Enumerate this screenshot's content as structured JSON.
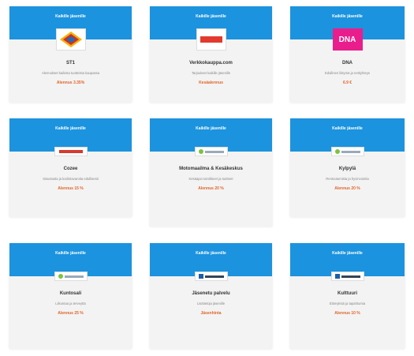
{
  "header_label": "Kaikille jäsenille",
  "accent_color": "#1b93de",
  "offer_color": "#e2652a",
  "cards": [
    {
      "name": "ST1",
      "desc": "Alennukset kaikista tuotteista kaupassa",
      "offer": "Alennus 3.35%",
      "logo": "st1-logo"
    },
    {
      "name": "Verkkokauppa.com",
      "desc": "Tarjoukset kaikille jäsenille",
      "offer": "Kesäalennus",
      "logo": "verkkokauppa-logo"
    },
    {
      "name": "DNA",
      "desc": "Edullinen liittymä ja nettiyhteys",
      "offer": "6.9 €",
      "logo": "dna-logo"
    },
    {
      "name": "Cozee",
      "desc": "Sisustusta ja kodintavaroita edullisesti",
      "offer": "Alennus 15 %",
      "logo": "cozee-logo"
    },
    {
      "name": "Motomaailma & Kesäkeskus",
      "desc": "Kesäajan tarvikkeet ja tuotteet",
      "offer": "Alennus 20 %",
      "logo": "partner-logo-green"
    },
    {
      "name": "Kylpylä",
      "desc": "Rentoutumista ja hyvinvointia",
      "offer": "Alennus 20 %",
      "logo": "partner-logo-green"
    },
    {
      "name": "Kuntosali",
      "desc": "Liikuntaa ja terveyttä",
      "offer": "Alennus 25 %",
      "logo": "partner-logo-green"
    },
    {
      "name": "Jäsenetu palvelu",
      "desc": "Lisätietoja jäsenille",
      "offer": "Jäsenhinta",
      "logo": "partner-logo-blue"
    },
    {
      "name": "Kulttuuri",
      "desc": "Elämyksiä ja tapahtumia",
      "offer": "Alennus 10 %",
      "logo": "partner-logo-blue"
    }
  ]
}
